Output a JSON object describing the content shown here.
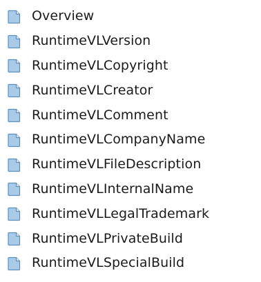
{
  "topics": [
    {
      "label": "Overview",
      "icon": "page-icon"
    },
    {
      "label": "RuntimeVLVersion",
      "icon": "page-icon"
    },
    {
      "label": "RuntimeVLCopyright",
      "icon": "page-icon"
    },
    {
      "label": "RuntimeVLCreator",
      "icon": "page-icon"
    },
    {
      "label": "RuntimeVLComment",
      "icon": "page-icon"
    },
    {
      "label": "RuntimeVLCompanyName",
      "icon": "page-icon"
    },
    {
      "label": "RuntimeVLFileDescription",
      "icon": "page-icon"
    },
    {
      "label": "RuntimeVLInternalName",
      "icon": "page-icon"
    },
    {
      "label": "RuntimeVLLegalTrademark",
      "icon": "page-icon"
    },
    {
      "label": "RuntimeVLPrivateBuild",
      "icon": "page-icon"
    },
    {
      "label": "RuntimeVLSpecialBuild",
      "icon": "page-icon"
    }
  ],
  "colors": {
    "icon_fill": "#a9cbe7",
    "icon_border": "#5a8fc0",
    "icon_fold": "#e3eef8",
    "text": "#1a1a1a"
  }
}
